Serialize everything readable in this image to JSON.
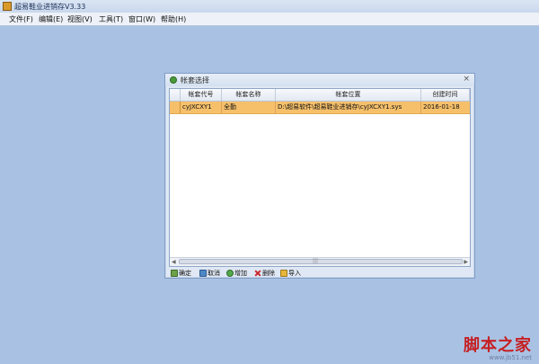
{
  "app": {
    "title": "超易鞋业进销存V3.33"
  },
  "menu": {
    "items": [
      {
        "label": "文件(F)"
      },
      {
        "label": "编辑(E)"
      },
      {
        "label": "视图(V)"
      },
      {
        "label": "工具(T)"
      },
      {
        "label": "窗口(W)"
      },
      {
        "label": "帮助(H)"
      }
    ]
  },
  "dialog": {
    "title": "帐套选择",
    "close": "×",
    "columns": [
      "帐套代号",
      "帐套名称",
      "帐套位置",
      "创建时间"
    ],
    "rows": [
      {
        "code": "cyJXCXY1",
        "name": "全勤",
        "path": "D:\\超易软件\\超易鞋业进销存\\cyJXCXY1.sys",
        "created": "2016-01-18"
      }
    ],
    "scroll_grip": "|||",
    "buttons": {
      "ok": "确定",
      "cancel": "取消",
      "add": "增加",
      "delete": "删除",
      "import": "导入"
    }
  },
  "watermark": {
    "text": "脚本之家",
    "url": "www.jb51.net"
  }
}
